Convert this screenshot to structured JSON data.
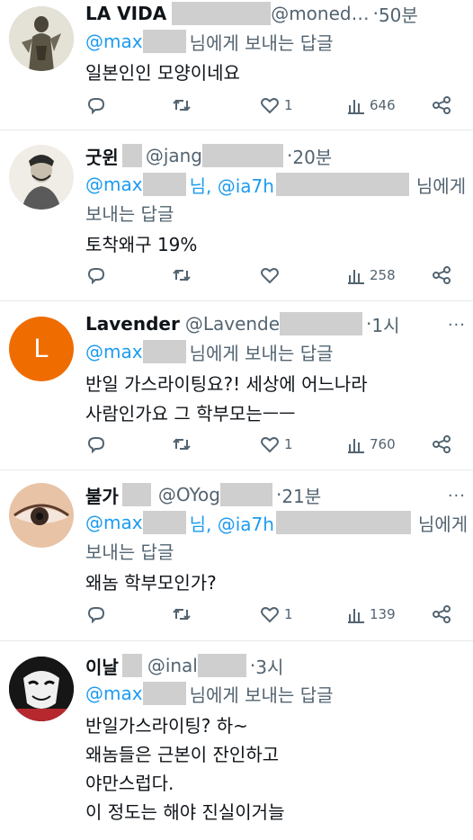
{
  "tweets": [
    {
      "name": "LA VIDA",
      "handle": "@moned…",
      "time": "50분",
      "reply_prefix": "@max",
      "reply_suffix": "님에게 보내는 답글",
      "text_lines": [
        "일본인인 모양이네요"
      ],
      "likes": "1",
      "views": "646",
      "avatar": "statue-avatar"
    },
    {
      "name": "굿윈",
      "handle": "@jang",
      "time": "20분",
      "reply_prefix": "@max",
      "reply_mid": "님, @ia7h",
      "reply_suffix": "님에게",
      "reply_line2": "보내는 답글",
      "text_lines": [
        "토착왜구 19%"
      ],
      "likes": "",
      "views": "258",
      "avatar": "sketch-portrait-avatar"
    },
    {
      "name": "Lavender",
      "handle": "@Lavende",
      "time": "1시",
      "reply_prefix": "@max",
      "reply_suffix": "님에게 보내는 답글",
      "text_lines": [
        "반일 가스라이팅요?! 세상에 어느나라",
        "사람인가요 그 학부모는ㅡㅡ"
      ],
      "likes": "1",
      "views": "760",
      "avatar_letter": "L",
      "avatar_color": "#ef6c00"
    },
    {
      "name": "불가",
      "handle": "@OYog",
      "time": "21분",
      "reply_prefix": "@max",
      "reply_mid": "님, @ia7h",
      "reply_suffix": "님에게",
      "reply_line2": "보내는 답글",
      "text_lines": [
        "왜놈 학부모인가?"
      ],
      "likes": "1",
      "views": "139",
      "avatar": "eye-avatar"
    },
    {
      "name": "이날",
      "handle": "@inal",
      "time": "3시",
      "reply_prefix": "@max",
      "reply_suffix": "님에게 보내는 답글",
      "text_lines": [
        "반일가스라이팅? 하~",
        "왜놈들은 근본이 잔인하고",
        "야만스럽다.",
        "이 정도는 해야 진실이거늘"
      ],
      "avatar": "mask-avatar"
    }
  ],
  "colors": {
    "accent": "#1d9bf0",
    "muted": "#536471",
    "redaction": "#cfcfcf"
  }
}
